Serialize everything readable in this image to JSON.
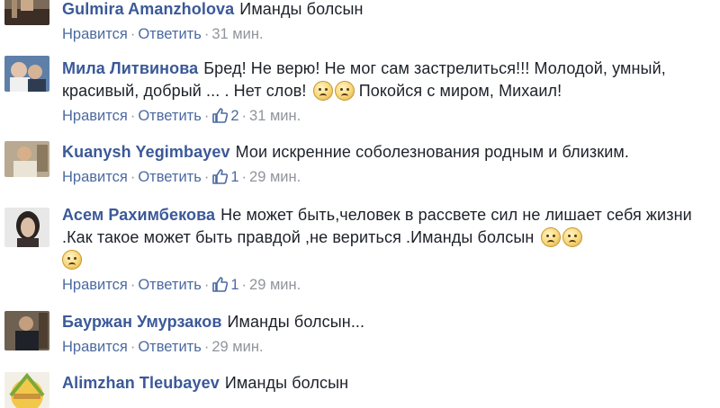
{
  "labels": {
    "like": "Нравится",
    "reply": "Ответить",
    "separator": "·"
  },
  "comments": [
    {
      "author": "Gulmira Amanzholova",
      "text": "Иманды болсын",
      "emoji_count": 0,
      "likes": "",
      "time": "31 мин."
    },
    {
      "author": "Мила Литвинова",
      "text": "Бред! Не верю! Не мог сам застрелиться!!! Молодой, умный, красивый, добрый ... . Нет слов!",
      "emoji_count": 2,
      "tail": " Покойся с миром, Михаил!",
      "likes": "2",
      "time": "31 мин."
    },
    {
      "author": "Kuanysh Yegimbayev",
      "text": "Мои искренние соболезнования родным и близким.",
      "emoji_count": 0,
      "likes": "1",
      "time": "29 мин."
    },
    {
      "author": "Асем Рахимбекова",
      "text": "Не может быть,человек в рассвете сил не лишает себя жизни .Как такое может быть правдой ,не вериться .Иманды болсын",
      "emoji_count": 3,
      "likes": "1",
      "time": "29 мин."
    },
    {
      "author": "Бауржан Умурзаков",
      "text": "Иманды болсын...",
      "emoji_count": 0,
      "likes": "",
      "time": "29 мин."
    },
    {
      "author": "Alimzhan Tleubayev",
      "text": "Иманды болсын",
      "emoji_count": 0,
      "likes": "",
      "time": "29 мин."
    }
  ],
  "icons": {
    "like": "thumbs-up-icon",
    "emoji": "sad-face-emoji-icon"
  },
  "colors": {
    "author": "#3b5998",
    "link": "#4b6aa1",
    "meta": "#90949c",
    "text": "#1d2129"
  }
}
